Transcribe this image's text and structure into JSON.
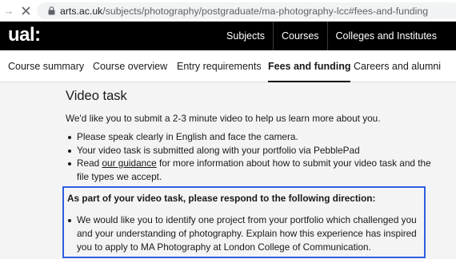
{
  "browser": {
    "url_host": "arts.ac.uk",
    "url_path": "/subjects/photography/postgraduate/ma-photography-lcc#fees-and-funding"
  },
  "header": {
    "logo": "ual:",
    "nav": [
      "Subjects",
      "Courses",
      "Colleges and Institutes"
    ]
  },
  "tabs": [
    {
      "label": "Course summary"
    },
    {
      "label": "Course overview"
    },
    {
      "label": "Entry requirements"
    },
    {
      "label": "Fees and funding",
      "active": true
    },
    {
      "label": "Careers and alumni"
    }
  ],
  "main": {
    "title": "Video task",
    "intro": "We'd like you to submit a 2-3 minute video to help us learn more about you.",
    "bullets": {
      "b1": "Please speak clearly in English and face the camera.",
      "b2": "Your video task is submitted along with your portfolio via PebblePad",
      "b3_prefix": "Read ",
      "b3_link": "our guidance",
      "b3_suffix": " for more information about how to submit your video task and the file types we accept."
    },
    "direction": {
      "heading": "As part of your video task, please respond to the following direction:",
      "item": "We would like you to identify one project from your portfolio which challenged you and your understanding of photography. Explain how this experience has inspired you to apply to MA Photography at London College of Communication."
    }
  },
  "colors": {
    "accent_box_border": "#2f5fe0",
    "header_bg": "#000000",
    "page_bg": "#f4f4f4"
  }
}
